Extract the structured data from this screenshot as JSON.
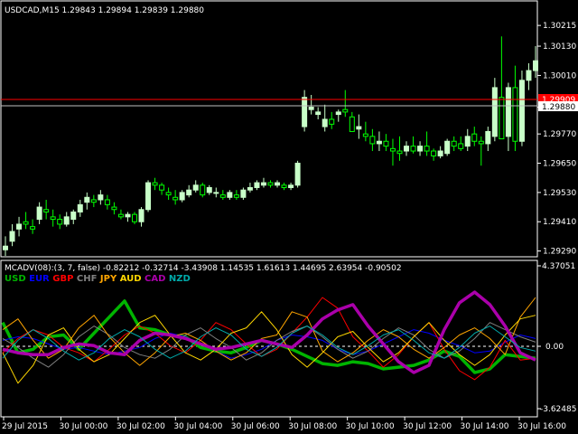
{
  "main_chart": {
    "header": "USDCAD,M15  1.29843 1.29894 1.29839 1.29880",
    "price_ticks": [
      "1.30215",
      "1.30130",
      "1.30010",
      "1.29880",
      "1.29770",
      "1.29650",
      "1.29530",
      "1.29410",
      "1.29290"
    ],
    "red_line_label": "1.29909",
    "current_price_label": "1.29880"
  },
  "indicator": {
    "header": "MCADV(08):(3, 7, false) -0.82212 -0.32714 -3.43908 1.14535 1.61613 1.44695 2.63954 -0.90502",
    "max_label": "4.37051",
    "zero_label": "0.00",
    "min_label": "-3.62485",
    "currencies": [
      {
        "code": "USD",
        "color": "#00b400"
      },
      {
        "code": "EUR",
        "color": "#0000ff"
      },
      {
        "code": "GBP",
        "color": "#ff0000"
      },
      {
        "code": "CHF",
        "color": "#808080"
      },
      {
        "code": "JPY",
        "color": "#ffa500"
      },
      {
        "code": "AUD",
        "color": "#ffd700"
      },
      {
        "code": "CAD",
        "color": "#aa00aa"
      },
      {
        "code": "NZD",
        "color": "#00aaaa"
      }
    ]
  },
  "time_axis": [
    "29 Jul 2015",
    "30 Jul 00:00",
    "30 Jul 02:00",
    "30 Jul 04:00",
    "30 Jul 06:00",
    "30 Jul 08:00",
    "30 Jul 10:00",
    "30 Jul 12:00",
    "30 Jul 14:00",
    "30 Jul 16:00"
  ],
  "colors": {
    "bull": "#c8ffc8",
    "bear": "#00ff00",
    "grid": "#ffffff",
    "zero": "#ffffff",
    "red_line": "#ff0000"
  },
  "chart_data": [
    {
      "type": "candlestick",
      "title": "USDCAD,M15",
      "ylim": [
        1.2927,
        1.3026
      ],
      "series": [
        {
          "name": "USDCAD",
          "values": [
            [
              1.29295,
              1.2935,
              1.2927,
              1.2931
            ],
            [
              1.2933,
              1.294,
              1.2931,
              1.2937
            ],
            [
              1.2938,
              1.2943,
              1.2935,
              1.294
            ],
            [
              1.2941,
              1.2945,
              1.2938,
              1.294
            ],
            [
              1.2939,
              1.2942,
              1.2936,
              1.2938
            ],
            [
              1.2942,
              1.2949,
              1.294,
              1.2947
            ],
            [
              1.2946,
              1.295,
              1.2942,
              1.2945
            ],
            [
              1.2943,
              1.2946,
              1.2939,
              1.2942
            ],
            [
              1.2942,
              1.2944,
              1.2938,
              1.294
            ],
            [
              1.294,
              1.2945,
              1.2939,
              1.2943
            ],
            [
              1.2942,
              1.2946,
              1.294,
              1.2945
            ],
            [
              1.2945,
              1.295,
              1.2943,
              1.2948
            ],
            [
              1.2949,
              1.2953,
              1.2946,
              1.2951
            ],
            [
              1.295,
              1.2952,
              1.2947,
              1.2949
            ],
            [
              1.295,
              1.2954,
              1.2948,
              1.2952
            ],
            [
              1.295,
              1.2952,
              1.2946,
              1.2948
            ],
            [
              1.2947,
              1.2949,
              1.2944,
              1.2946
            ],
            [
              1.2944,
              1.2946,
              1.2942,
              1.2943
            ],
            [
              1.2943,
              1.2945,
              1.2941,
              1.2944
            ],
            [
              1.2944,
              1.2945,
              1.294,
              1.2941
            ],
            [
              1.2941,
              1.2947,
              1.2939,
              1.2946
            ],
            [
              1.2946,
              1.2958,
              1.2945,
              1.2957
            ],
            [
              1.2957,
              1.2959,
              1.2954,
              1.2956
            ],
            [
              1.2956,
              1.2957,
              1.2952,
              1.2954
            ],
            [
              1.2953,
              1.2955,
              1.295,
              1.2952
            ],
            [
              1.2951,
              1.2954,
              1.2948,
              1.295
            ],
            [
              1.295,
              1.2954,
              1.2949,
              1.2953
            ],
            [
              1.2952,
              1.2956,
              1.2951,
              1.2954
            ],
            [
              1.2954,
              1.2958,
              1.2953,
              1.2956
            ],
            [
              1.2956,
              1.2957,
              1.2951,
              1.2952
            ],
            [
              1.2953,
              1.2956,
              1.2952,
              1.2955
            ],
            [
              1.2953,
              1.2955,
              1.2951,
              1.2953
            ],
            [
              1.2952,
              1.2954,
              1.295,
              1.2951
            ],
            [
              1.2951,
              1.2954,
              1.295,
              1.2953
            ],
            [
              1.2952,
              1.2954,
              1.295,
              1.2951
            ],
            [
              1.2951,
              1.2955,
              1.295,
              1.2954
            ],
            [
              1.2954,
              1.2957,
              1.2953,
              1.2955
            ],
            [
              1.2955,
              1.2958,
              1.2954,
              1.2957
            ],
            [
              1.2956,
              1.2959,
              1.2955,
              1.2957
            ],
            [
              1.2957,
              1.2958,
              1.2955,
              1.2956
            ],
            [
              1.2956,
              1.2958,
              1.2955,
              1.2957
            ],
            [
              1.2956,
              1.2957,
              1.2954,
              1.2955
            ],
            [
              1.2955,
              1.2957,
              1.2954,
              1.2956
            ],
            [
              1.2956,
              1.2966,
              1.2955,
              1.2965
            ],
            [
              1.298,
              1.2995,
              1.2978,
              1.2992
            ],
            [
              1.2987,
              1.2993,
              1.2985,
              1.2988
            ],
            [
              1.2985,
              1.2988,
              1.2983,
              1.2986
            ],
            [
              1.298,
              1.2989,
              1.2978,
              1.2983
            ],
            [
              1.2983,
              1.2986,
              1.2979,
              1.2981
            ],
            [
              1.2985,
              1.2987,
              1.2982,
              1.2986
            ],
            [
              1.2987,
              1.2995,
              1.2984,
              1.2986
            ],
            [
              1.2984,
              1.2986,
              1.2978,
              1.2978
            ],
            [
              1.2979,
              1.2985,
              1.2975,
              1.298
            ],
            [
              1.2977,
              1.2982,
              1.2974,
              1.2976
            ],
            [
              1.2976,
              1.2979,
              1.297,
              1.2973
            ],
            [
              1.2973,
              1.2978,
              1.297,
              1.2974
            ],
            [
              1.2974,
              1.2977,
              1.297,
              1.2972
            ],
            [
              1.2971,
              1.2975,
              1.2964,
              1.297
            ],
            [
              1.297,
              1.2976,
              1.2966,
              1.2969
            ],
            [
              1.297,
              1.2974,
              1.2968,
              1.2972
            ],
            [
              1.2972,
              1.2976,
              1.2969,
              1.297
            ],
            [
              1.297,
              1.2974,
              1.2968,
              1.2972
            ],
            [
              1.2972,
              1.2978,
              1.2968,
              1.297
            ],
            [
              1.297,
              1.2971,
              1.2966,
              1.2968
            ],
            [
              1.2968,
              1.2972,
              1.2967,
              1.297
            ],
            [
              1.2969,
              1.2975,
              1.2968,
              1.2974
            ],
            [
              1.2974,
              1.2976,
              1.297,
              1.2972
            ],
            [
              1.2973,
              1.2976,
              1.297,
              1.2971
            ],
            [
              1.2972,
              1.2979,
              1.297,
              1.2976
            ],
            [
              1.2977,
              1.298,
              1.2972,
              1.2974
            ],
            [
              1.2974,
              1.2976,
              1.2964,
              1.2973
            ],
            [
              1.2973,
              1.298,
              1.297,
              1.2978
            ],
            [
              1.2976,
              1.3,
              1.2974,
              1.2996
            ],
            [
              1.2992,
              1.3017,
              1.2985,
              1.2975
            ],
            [
              1.2976,
              1.2998,
              1.297,
              1.2996
            ],
            [
              1.2996,
              1.3005,
              1.297,
              1.2974
            ],
            [
              1.2974,
              1.3003,
              1.2972,
              1.2999
            ],
            [
              1.2999,
              1.3006,
              1.2995,
              1.3003
            ],
            [
              1.3003,
              1.3013,
              1.3,
              1.3007
            ]
          ]
        }
      ]
    },
    {
      "type": "line",
      "title": "MCADV(08):(3, 7, false)",
      "ylim": [
        -3.62485,
        4.37051
      ],
      "series": [
        {
          "name": "USD",
          "values": [
            1.2,
            -0.5,
            -0.3,
            0.4,
            0.5,
            -0.3,
            0.6,
            1.5,
            2.4,
            0.9,
            0.8,
            0.5,
            0.4,
            -0.2,
            -0.4,
            -0.5,
            -0.2,
            0.2,
            0.0,
            -0.3,
            -0.7,
            -1.1,
            -1.2,
            -1.0,
            -1.1,
            -1.4,
            -1.3,
            -1.2,
            -0.9,
            -0.4,
            -0.7,
            -1.6,
            -1.4,
            -0.6,
            -0.7,
            -0.8
          ]
        },
        {
          "name": "EUR",
          "values": [
            0.2,
            0.4,
            0.3,
            0.0,
            -0.3,
            -0.2,
            -0.4,
            -0.6,
            -0.4,
            -0.2,
            0.3,
            0.6,
            0.4,
            0.0,
            -0.4,
            -0.8,
            -0.6,
            -0.3,
            0.2,
            0.5,
            0.4,
            0.2,
            -0.3,
            -0.6,
            -0.4,
            0.0,
            0.4,
            0.8,
            0.6,
            0.2,
            -0.1,
            -0.5,
            -0.4,
            0.1,
            0.5,
            0.3
          ]
        },
        {
          "name": "GBP",
          "values": [
            -0.5,
            0.3,
            0.8,
            0.5,
            -0.2,
            -0.5,
            -1.0,
            -0.3,
            0.5,
            1.0,
            0.6,
            -0.1,
            -0.5,
            0.2,
            1.2,
            0.8,
            0.0,
            -0.7,
            -0.3,
            0.6,
            1.5,
            2.6,
            2.0,
            0.4,
            -0.4,
            -1.3,
            -0.6,
            0.4,
            1.2,
            -0.3,
            -1.5,
            -2.0,
            -1.3,
            0.2,
            -0.9,
            -0.8
          ]
        },
        {
          "name": "CHF",
          "values": [
            0.3,
            -0.2,
            -0.8,
            -1.3,
            -0.6,
            0.4,
            1.0,
            0.5,
            -0.2,
            -0.6,
            -0.8,
            -0.3,
            0.5,
            0.9,
            0.3,
            -0.2,
            -0.9,
            -0.5,
            0.2,
            0.7,
            1.0,
            0.4,
            -0.3,
            -0.8,
            -0.4,
            0.3,
            0.9,
            0.5,
            -0.3,
            -0.8,
            -0.4,
            0.3,
            1.2,
            0.8,
            0.4,
            0.1
          ]
        },
        {
          "name": "JPY",
          "values": [
            0.8,
            1.4,
            0.2,
            -0.8,
            -0.3,
            0.9,
            1.6,
            0.4,
            -0.5,
            -1.2,
            -0.5,
            0.4,
            0.6,
            0.2,
            -0.4,
            -0.9,
            -0.5,
            0.3,
            0.5,
            1.8,
            1.5,
            -0.4,
            -1.0,
            -0.5,
            0.2,
            0.8,
            0.4,
            -0.3,
            -0.8,
            -0.2,
            0.5,
            0.9,
            0.3,
            -0.6,
            1.5,
            2.6
          ]
        },
        {
          "name": "AUD",
          "values": [
            -0.5,
            -2.2,
            -1.2,
            0.5,
            0.9,
            -0.3,
            -1.0,
            -0.6,
            0.3,
            1.2,
            1.6,
            0.5,
            -0.5,
            -0.9,
            -0.3,
            0.6,
            0.9,
            1.8,
            0.8,
            -0.6,
            -1.3,
            -0.5,
            0.4,
            0.7,
            -0.2,
            -1.0,
            -0.5,
            0.4,
            1.2,
            0.2,
            -0.6,
            -1.2,
            -0.6,
            0.5,
            1.4,
            1.6
          ]
        },
        {
          "name": "CAD",
          "values": [
            -0.3,
            -0.5,
            -0.6,
            -0.6,
            -0.2,
            0.0,
            -0.1,
            -0.5,
            -0.6,
            0.2,
            0.6,
            0.5,
            0.3,
            0.0,
            -0.3,
            -0.2,
            0.0,
            0.2,
            0.0,
            -0.2,
            0.5,
            1.4,
            1.9,
            2.2,
            1.0,
            0.0,
            -1.0,
            -1.6,
            -1.2,
            0.8,
            2.3,
            2.9,
            2.2,
            1.0,
            -0.5,
            -0.9
          ]
        },
        {
          "name": "NZD",
          "values": [
            -0.8,
            0.2,
            0.8,
            0.3,
            -0.4,
            -0.9,
            -0.5,
            0.3,
            0.8,
            0.4,
            -0.3,
            -0.8,
            -0.4,
            0.4,
            0.9,
            0.5,
            -0.3,
            -0.7,
            -0.2,
            0.6,
            1.0,
            0.5,
            -0.2,
            -0.6,
            -0.1,
            0.5,
            0.8,
            0.2,
            -0.5,
            -0.8,
            -0.2,
            0.6,
            1.0,
            0.4,
            -0.2,
            -0.4
          ]
        }
      ]
    }
  ]
}
